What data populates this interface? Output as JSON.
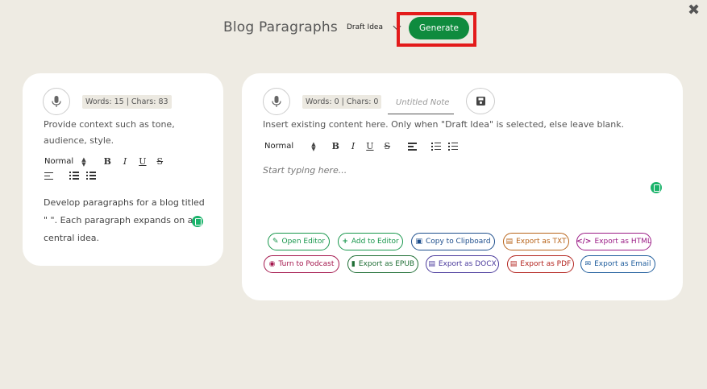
{
  "header": {
    "title": "Blog Paragraphs",
    "mode_selected": "Draft Idea",
    "generate_label": "Generate"
  },
  "close_label": "✖",
  "left_panel": {
    "counter": "Words: 15 | Chars: 83",
    "helper": "Provide context such as tone, audience, style.",
    "toolbar": {
      "format": "Normal",
      "bold": "B",
      "italic": "I",
      "underline": "U",
      "strike": "S"
    },
    "content": "Develop paragraphs for a blog titled \" \". Each paragraph expands on a central idea."
  },
  "right_panel": {
    "counter": "Words: 0 | Chars: 0",
    "note_placeholder": "Untitled Note",
    "helper": "Insert existing content here. Only when \"Draft Idea\" is selected, else leave blank.",
    "toolbar": {
      "format": "Normal",
      "bold": "B",
      "italic": "I",
      "underline": "U",
      "strike": "S"
    },
    "editor_placeholder": "Start typing here...",
    "actions": [
      {
        "label": "Open Editor",
        "icon": "✎",
        "color": "#17964b"
      },
      {
        "label": "Add to Editor",
        "icon": "+",
        "color": "#17964b"
      },
      {
        "label": "Copy to Clipboard",
        "icon": "▣",
        "color": "#1c4d8c"
      },
      {
        "label": "Export as TXT",
        "icon": "▤",
        "color": "#b8641a"
      },
      {
        "label": "Export as HTML",
        "icon": "</>",
        "color": "#9b1c86"
      },
      {
        "label": "Turn to Podcast",
        "icon": "◉",
        "color": "#a4174d"
      },
      {
        "label": "Export as EPUB",
        "icon": "▮",
        "color": "#1f6e35"
      },
      {
        "label": "Export as DOCX",
        "icon": "▤",
        "color": "#4a3a9c"
      },
      {
        "label": "Export as PDF",
        "icon": "▤",
        "color": "#b3241f"
      },
      {
        "label": "Export as Email",
        "icon": "✉",
        "color": "#1e5c9c"
      }
    ]
  }
}
